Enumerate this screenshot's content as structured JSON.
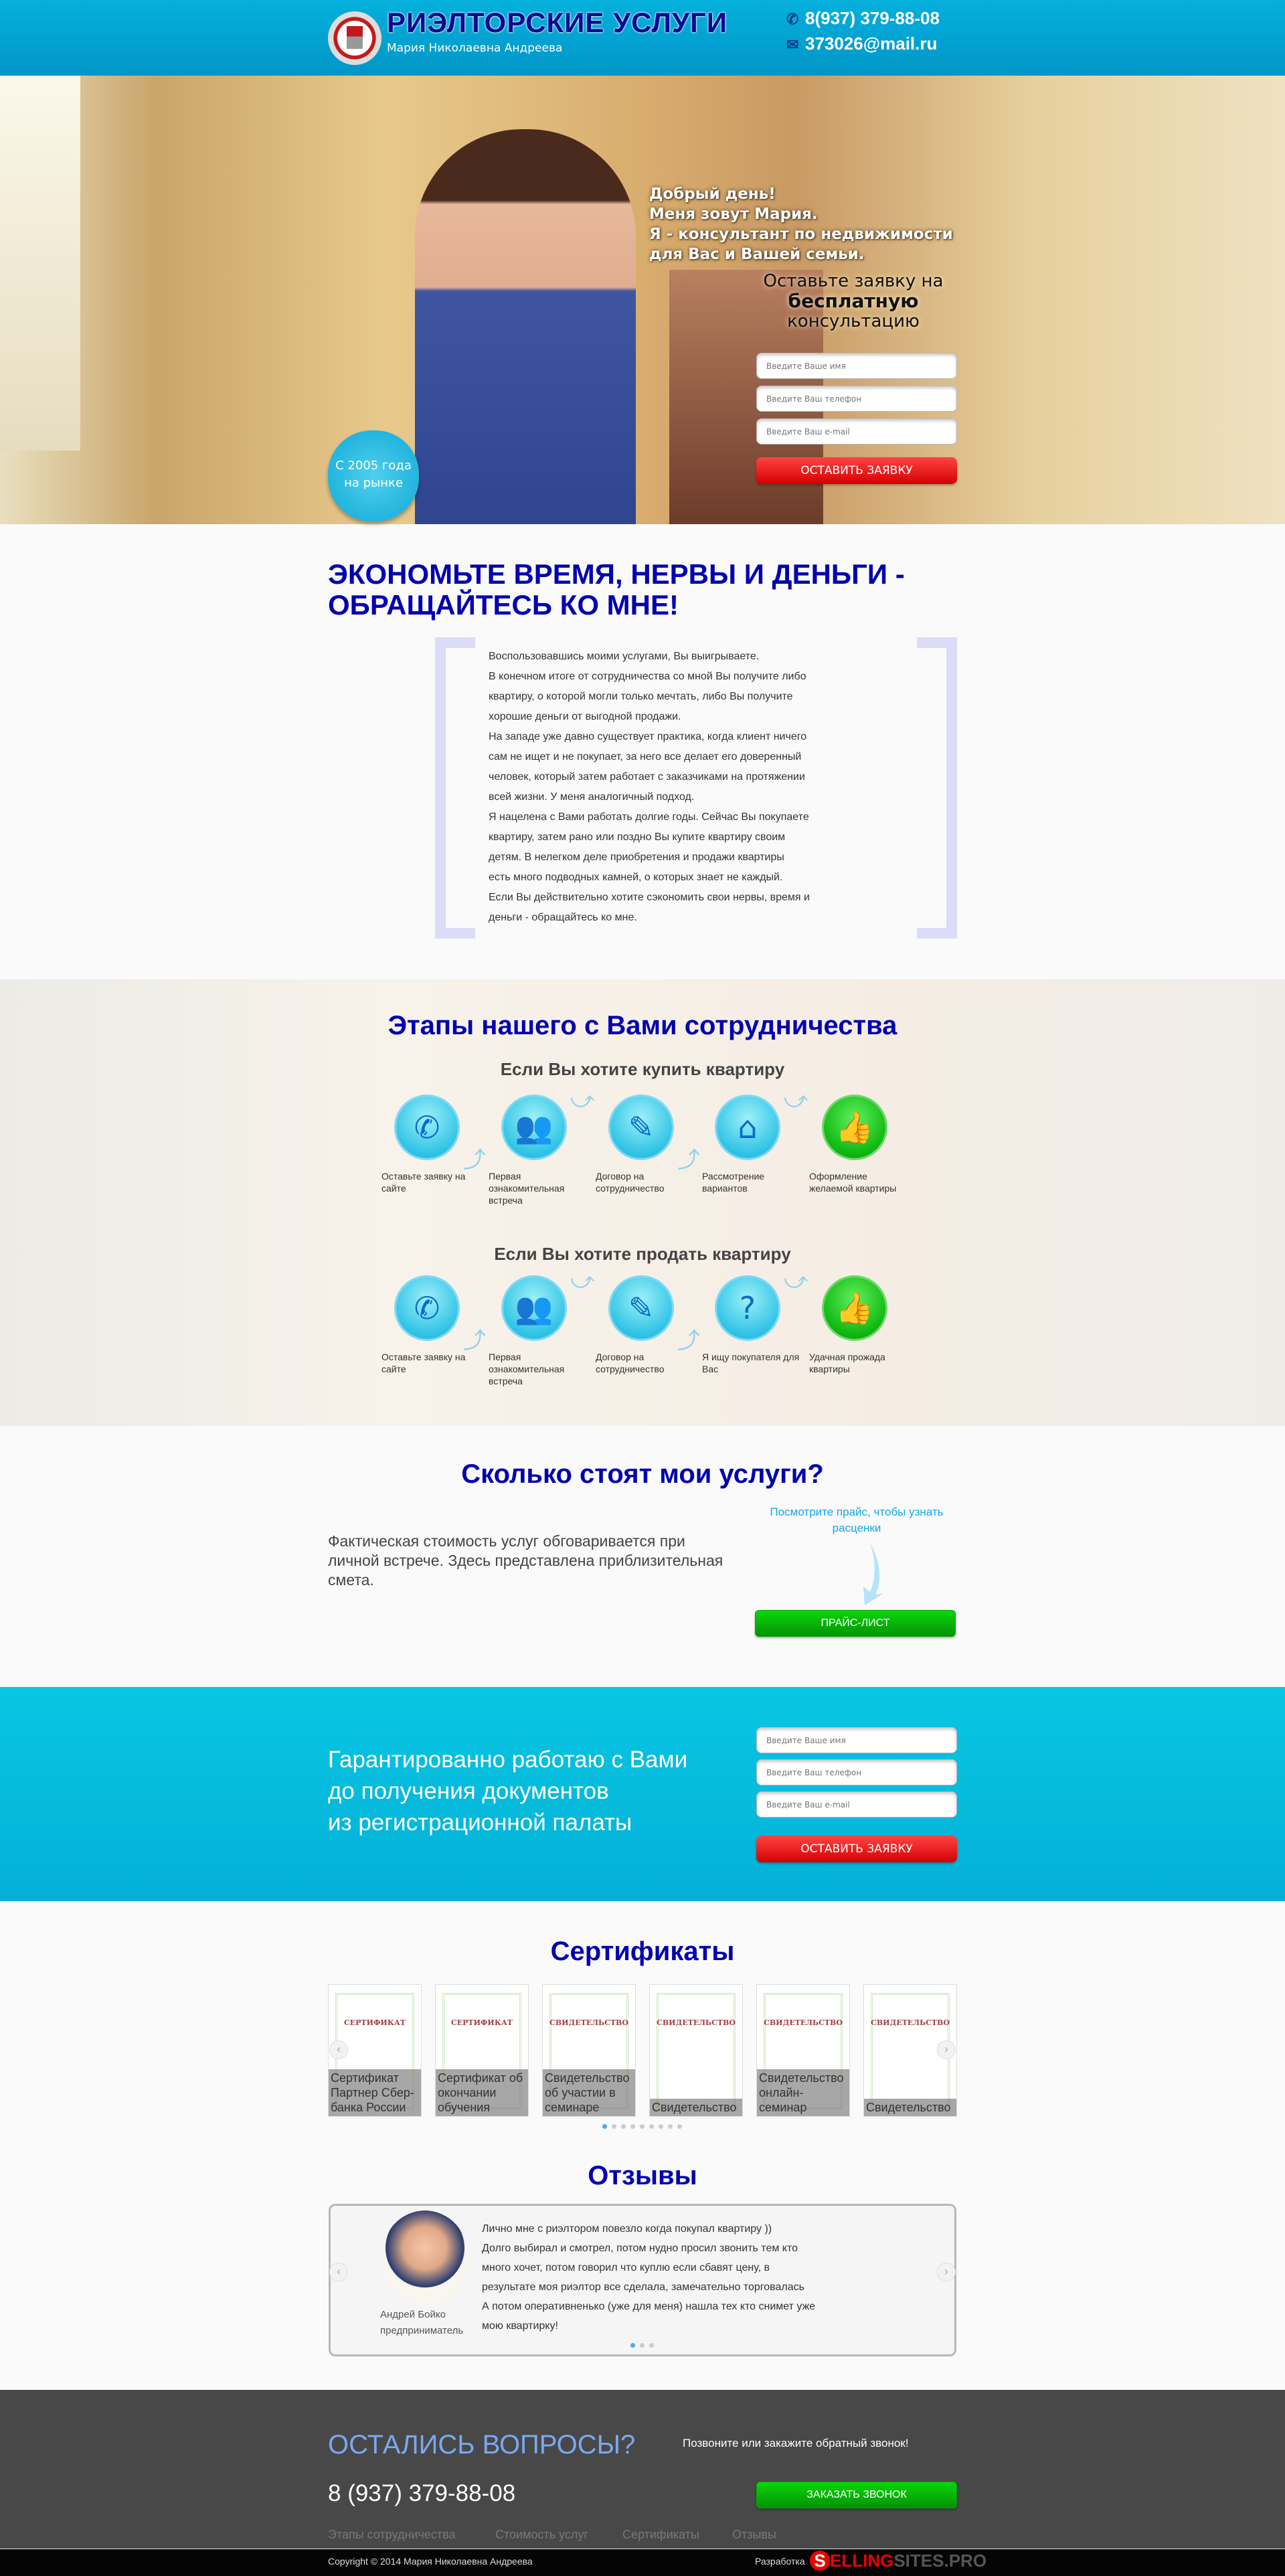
{
  "header": {
    "title": "РИЭЛТОРСКИЕ УСЛУГИ",
    "subtitle": "Мария Николаевна Андреева",
    "phone": "8(937) 379-88-08",
    "email": "373026@mail.ru"
  },
  "hero": {
    "greeting": [
      "Добрый день!",
      "Меня зовут Мария.",
      "Я - консультант по недвижимости",
      "для Вас и Вашей семьи."
    ],
    "cta_line1": "Оставьте заявку на",
    "cta_bold": "бесплатную",
    "cta_line3": "консультацию",
    "badge": "С 2005 года на рынке",
    "form": {
      "name_placeholder": "Введите Ваше имя",
      "phone_placeholder": "Введите Ваш телефон",
      "email_placeholder": "Введите Ваш e-mail",
      "submit": "ОСТАВИТЬ ЗАЯВКУ"
    }
  },
  "about": {
    "title": "ЭКОНОМЬТЕ ВРЕМЯ, НЕРВЫ И ДЕНЬГИ - ОБРАЩАЙТЕСЬ КО МНЕ!",
    "lines": [
      "Воспользовавшись моими услугами, Вы выигрываете.",
      "В конечном итоге от сотрудничества со мной Вы получите либо",
      "квартиру, о которой могли только мечтать, либо Вы получите",
      "хорошие деньги от выгодной продажи.",
      "На западе уже давно существует практика, когда клиент ничего",
      "сам не ищет и не покупает, за него все делает его доверенный",
      "человек, который затем работает с заказчиками на протяжении",
      "всей жизни. У меня аналогичный подход.",
      "Я нацелена с Вами работать долгие годы. Сейчас Вы покупаете",
      "квартиру, затем рано или поздно Вы купите квартиру своим",
      "детям. В нелегком деле приобретения и продажи квартиры",
      "есть много подводных камней, о которых знает не каждый.",
      "Если Вы действительно хотите сэкономить свои нервы, время и",
      "деньги - обращайтесь ко мне."
    ]
  },
  "steps": {
    "title": "Этапы нашего с Вами сотрудничества",
    "buy": {
      "title": "Если Вы хотите купить квартиру",
      "items": [
        {
          "icon": "phone-mail-icon",
          "label": "Оставьте заявку на сайте"
        },
        {
          "icon": "people-icon",
          "label": "Первая ознакомительная встреча"
        },
        {
          "icon": "document-pen-icon",
          "label": "Договор на сотрудничество"
        },
        {
          "icon": "question-house-icon",
          "label": "Рассмотрение вариантов"
        },
        {
          "icon": "thumbs-up-icon",
          "label": "Оформление желаемой квартиры"
        }
      ]
    },
    "sell": {
      "title": "Если Вы хотите продать квартиру",
      "items": [
        {
          "icon": "phone-mail-icon",
          "label": "Оставьте заявку на сайте"
        },
        {
          "icon": "people-icon",
          "label": "Первая ознакомительная встреча"
        },
        {
          "icon": "document-pen-icon",
          "label": "Договор на сотрудничество"
        },
        {
          "icon": "question-person-icon",
          "label": "Я ищу покупателя для Вас"
        },
        {
          "icon": "thumbs-up-icon",
          "label": "Удачная прожада квартиры"
        }
      ]
    }
  },
  "price": {
    "title": "Сколько стоят мои услуги?",
    "text": "Фактическая стоимость услуг обговаривается при личной встрече. Здесь представлена приблизительная смета.",
    "hint": "Посмотрите прайс, чтобы узнать расценки",
    "button": "ПРАЙС-ЛИСТ"
  },
  "guarantee": {
    "lines": [
      "Гарантированно работаю с Вами",
      "до получения документов",
      "из регистрационной палаты"
    ],
    "form": {
      "name_placeholder": "Введите Ваше имя",
      "phone_placeholder": "Введите Ваш телефон",
      "email_placeholder": "Введите Ваш e-mail",
      "submit": "ОСТАВИТЬ ЗАЯВКУ"
    }
  },
  "certificates": {
    "title": "Сертификаты",
    "items": [
      {
        "heading": "СЕРТИФИКАТ",
        "caption": "Сертификат Партнер Сбер-банка России"
      },
      {
        "heading": "СЕРТИФИКАТ",
        "caption": "Сертификат об окончании обучения"
      },
      {
        "heading": "СВИДЕТЕЛЬСТВО",
        "caption": "Свидетельство об участии в семинаре"
      },
      {
        "heading": "СВИДЕТЕЛЬСТВО",
        "caption": "Свидетельство"
      },
      {
        "heading": "СВИДЕТЕЛЬСТВО",
        "caption": "Свидетельство онлайн-семинар"
      },
      {
        "heading": "СВИДЕТЕЛЬСТВО",
        "caption": "Свидетельство"
      }
    ],
    "pages": 9,
    "active_page": 1
  },
  "reviews": {
    "title": "Отзывы",
    "name": "Андрей Бойко",
    "role": "предприниматель",
    "lines": [
      "Лично мне  с риэлтором повезло когда покупал квартиру ))",
      "Долго выбирал и смотрел, потом нудно просил звонить тем кто",
      "много хочет, потом говорил что куплю если сбавят цену, в",
      "результате моя риэлтор все сделала, замечательно торговалась",
      "А потом оперативненько (уже для меня) нашла тех кто снимет уже",
      "мою квартирку!"
    ],
    "pages": 3,
    "active_page": 1
  },
  "footer": {
    "title": "ОСТАЛИСЬ ВОПРОСЫ?",
    "call_text": "Позвоните  или закажите обратный звонок!",
    "phone": "8 (937) 379-88-08",
    "button": "ЗАКАЗАТЬ ЗВОНОК",
    "links": [
      "Этапы сотрудничества",
      "Стоимость услуг",
      "Сертификаты",
      "Отзывы"
    ],
    "copyright": "Copyright © 2014 Мария Николаевна Андреева",
    "dev_label": "Разработка",
    "dev_logo": "SELLINGSITES.PRO"
  },
  "colors": {
    "header": "#00a8d6",
    "heading": "#0000b0",
    "cta_red": "#e00000",
    "cta_green": "#06c206",
    "cyan_band": "#05b5d8",
    "footer": "#484848"
  }
}
